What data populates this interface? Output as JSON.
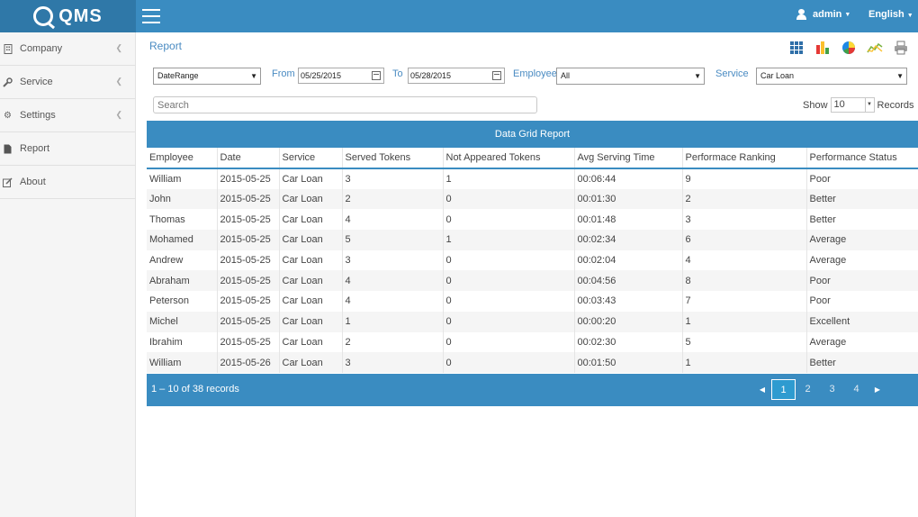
{
  "app": {
    "logo_text": "QMS"
  },
  "header": {
    "user": "admin",
    "language": "English"
  },
  "sidebar": {
    "items": [
      {
        "label": "Company",
        "icon": "building-icon",
        "has_arrow": true
      },
      {
        "label": "Service",
        "icon": "wrench-icon",
        "has_arrow": true
      },
      {
        "label": "Settings",
        "icon": "gear-icon",
        "has_arrow": true
      },
      {
        "label": "Report",
        "icon": "document-icon",
        "has_arrow": false
      },
      {
        "label": "About",
        "icon": "edit-icon",
        "has_arrow": false
      }
    ]
  },
  "page": {
    "title": "Report"
  },
  "toolbar": {
    "icons": [
      "grid-view-icon",
      "bar-chart-icon",
      "pie-chart-icon",
      "line-chart-icon",
      "print-icon"
    ]
  },
  "filters": {
    "range_type": "DateRange",
    "from_label": "From",
    "from_value": "05/25/2015",
    "to_label": "To",
    "to_value": "05/28/2015",
    "employee_label": "Employee",
    "employee_value": "All",
    "service_label": "Service",
    "service_value": "Car Loan"
  },
  "search": {
    "placeholder": "Search"
  },
  "show": {
    "label": "Show",
    "value": "10",
    "suffix": "Records"
  },
  "grid": {
    "title": "Data Grid Report",
    "columns": [
      "Employee",
      "Date",
      "Service",
      "Served Tokens",
      "Not Appeared Tokens",
      "Avg Serving Time",
      "Performace Ranking",
      "Performance Status"
    ],
    "rows": [
      [
        "William",
        "2015-05-25",
        "Car Loan",
        "3",
        "1",
        "00:06:44",
        "9",
        "Poor"
      ],
      [
        "John",
        "2015-05-25",
        "Car Loan",
        "2",
        "0",
        "00:01:30",
        "2",
        "Better"
      ],
      [
        "Thomas",
        "2015-05-25",
        "Car Loan",
        "4",
        "0",
        "00:01:48",
        "3",
        "Better"
      ],
      [
        "Mohamed",
        "2015-05-25",
        "Car Loan",
        "5",
        "1",
        "00:02:34",
        "6",
        "Average"
      ],
      [
        "Andrew",
        "2015-05-25",
        "Car Loan",
        "3",
        "0",
        "00:02:04",
        "4",
        "Average"
      ],
      [
        "Abraham",
        "2015-05-25",
        "Car Loan",
        "4",
        "0",
        "00:04:56",
        "8",
        "Poor"
      ],
      [
        "Peterson",
        "2015-05-25",
        "Car Loan",
        "4",
        "0",
        "00:03:43",
        "7",
        "Poor"
      ],
      [
        "Michel",
        "2015-05-25",
        "Car Loan",
        "1",
        "0",
        "00:00:20",
        "1",
        "Excellent"
      ],
      [
        "Ibrahim",
        "2015-05-25",
        "Car Loan",
        "2",
        "0",
        "00:02:30",
        "5",
        "Average"
      ],
      [
        "William",
        "2015-05-26",
        "Car Loan",
        "3",
        "0",
        "00:01:50",
        "1",
        "Better"
      ]
    ]
  },
  "pager": {
    "info": "1 – 10 of 38 records",
    "pages": [
      "1",
      "2",
      "3",
      "4"
    ],
    "active_page": "1"
  },
  "colors": {
    "accent": "#3a8cc1",
    "logo_bg": "#2f78a8",
    "link": "#4a8bc2"
  }
}
